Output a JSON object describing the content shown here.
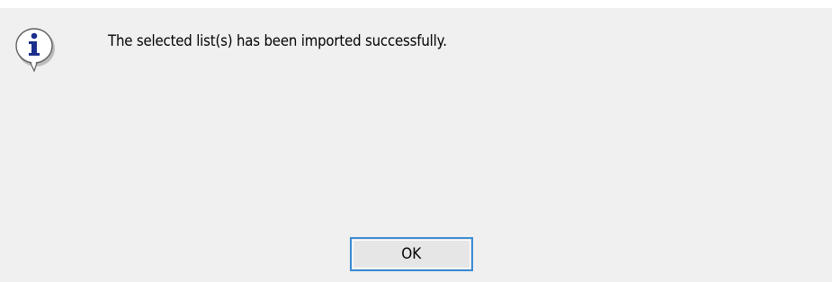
{
  "dialog": {
    "message": "The selected list(s) has been imported successfully.",
    "ok_label": "OK",
    "icon": "info-speech-bubble-icon"
  },
  "colors": {
    "background": "#f0f0f0",
    "button_border": "#3a8cd4",
    "icon_blue": "#1b2e8c"
  }
}
